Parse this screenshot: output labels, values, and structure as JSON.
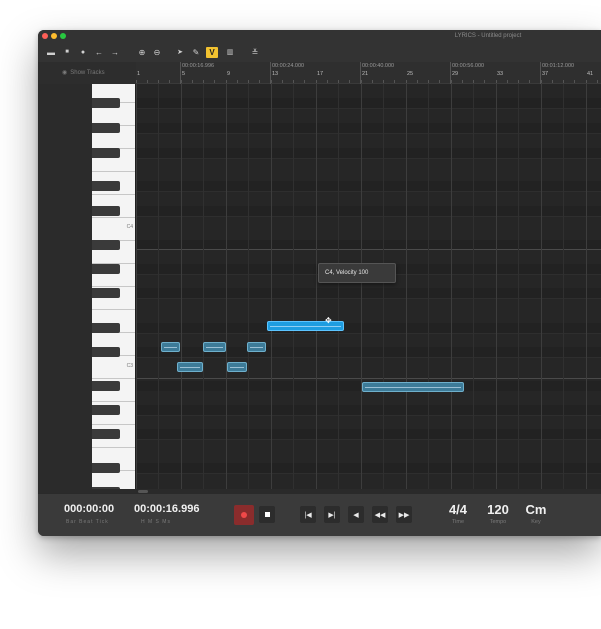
{
  "window": {
    "title": "LYRICS - Untitled project",
    "traffic_colors": {
      "close": "#fe5f57",
      "minimize": "#febc2e",
      "maximize": "#28c840"
    }
  },
  "toolbar": {
    "buttons": [
      {
        "id": "open",
        "icon": "folder-icon",
        "glyph": "▬"
      },
      {
        "id": "save",
        "icon": "save-icon",
        "glyph": "■"
      },
      {
        "id": "info",
        "icon": "info-icon",
        "glyph": "●"
      },
      {
        "id": "back",
        "icon": "arrow-left-icon",
        "glyph": "←"
      },
      {
        "id": "forward",
        "icon": "arrow-right-icon",
        "glyph": "→"
      },
      {
        "id": "zoom-in",
        "icon": "zoom-in-icon",
        "glyph": "⊕"
      },
      {
        "id": "zoom-out",
        "icon": "zoom-out-icon",
        "glyph": "⊖"
      },
      {
        "id": "pointer",
        "icon": "pointer-icon",
        "glyph": "➤"
      },
      {
        "id": "pencil",
        "icon": "pencil-icon",
        "glyph": "✎"
      },
      {
        "id": "velocity",
        "icon": "velocity-icon",
        "glyph": "V",
        "active": true
      },
      {
        "id": "delete",
        "icon": "trash-icon",
        "glyph": "▥"
      },
      {
        "id": "quantize",
        "icon": "quantize-icon",
        "glyph": "≚"
      }
    ],
    "active_color": "#f2c230"
  },
  "tracks": {
    "show_label": "Show Tracks",
    "icon": "eye-icon"
  },
  "ruler": {
    "times": [
      "00:00:16.996",
      "00:00:24.000",
      "00:00:40.000",
      "00:00:56.000",
      "00:01:12.000"
    ],
    "bars": [
      "1",
      "5",
      "9",
      "13",
      "17",
      "21",
      "25",
      "29",
      "33",
      "37",
      "41"
    ]
  },
  "piano": {
    "labels": [
      "C4",
      "C3"
    ]
  },
  "notes_color": {
    "normal": "#3d7b98",
    "selected": "#1e9de0"
  },
  "tooltip": {
    "text": "C4, Velocity 100"
  },
  "transport": {
    "position": {
      "value": "000:00:00",
      "sub": "Bar  Beat  Tick"
    },
    "time": {
      "value": "00:00:16.996",
      "sub": "H   M   S   Ms"
    },
    "buttons": [
      {
        "id": "record",
        "icon": "record-icon"
      },
      {
        "id": "stop",
        "icon": "stop-icon"
      },
      {
        "id": "go-start",
        "icon": "skip-start-icon",
        "glyph": "|◀"
      },
      {
        "id": "go-end",
        "icon": "skip-end-icon",
        "glyph": "▶|"
      },
      {
        "id": "step-back",
        "icon": "step-back-icon",
        "glyph": "◀"
      },
      {
        "id": "rewind",
        "icon": "rewind-icon",
        "glyph": "◀◀"
      },
      {
        "id": "fast-forward",
        "icon": "fast-forward-icon",
        "glyph": "▶▶"
      }
    ],
    "time_signature": {
      "value": "4/4",
      "label": "Time"
    },
    "tempo": {
      "value": "120",
      "label": "Tempo"
    },
    "key": {
      "value": "Cm",
      "label": "Key"
    }
  }
}
